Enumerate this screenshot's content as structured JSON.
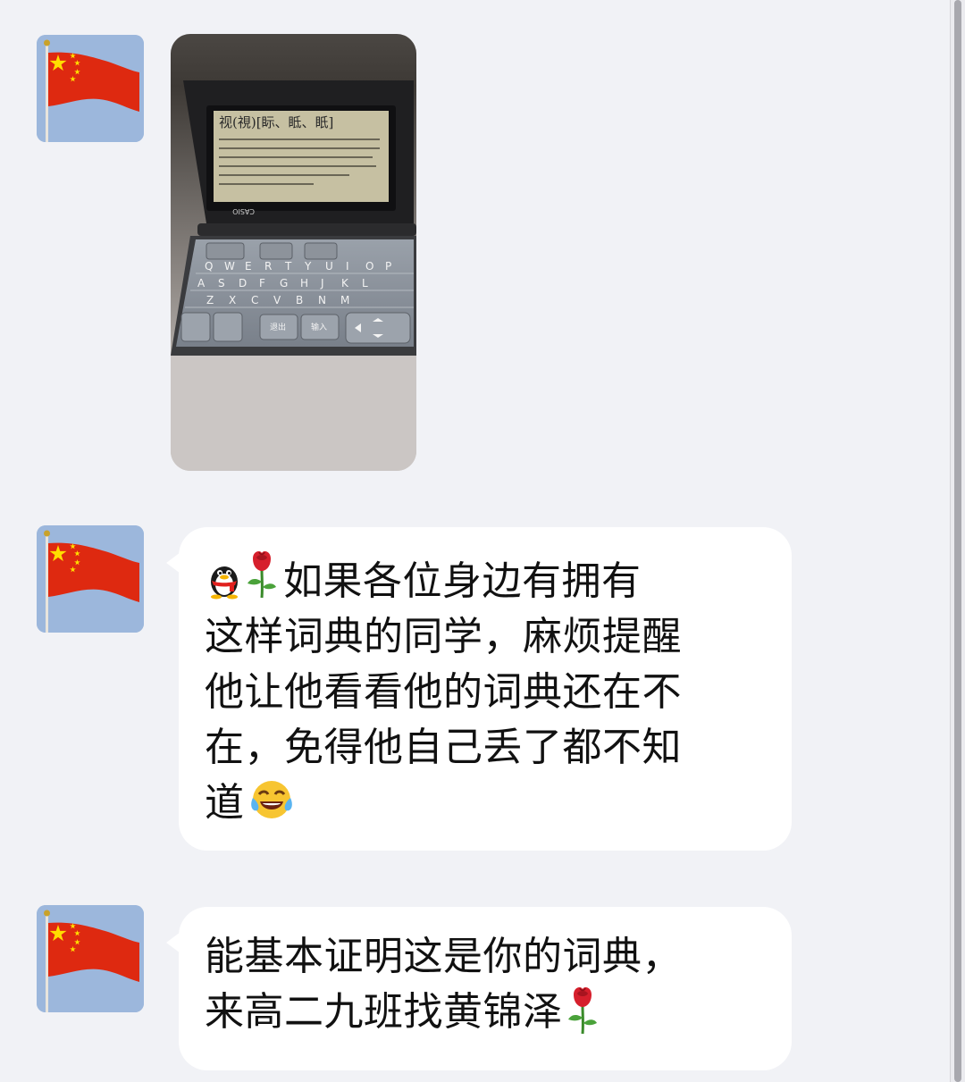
{
  "messages": [
    {
      "type": "image",
      "avatar_icon": "china-flag-icon",
      "photo": {
        "subject": "electronic-dictionary-photo",
        "brand_text": "CASIO",
        "screen_heading": "视(視)[眎、眡、眂]",
        "key_row_1": [
          "Q",
          "W",
          "E",
          "R",
          "T",
          "Y",
          "U",
          "I",
          "O",
          "P"
        ],
        "key_row_2": [
          "A",
          "S",
          "D",
          "F",
          "G",
          "H",
          "J",
          "K",
          "L"
        ],
        "key_row_3": [
          "Z",
          "X",
          "C",
          "V",
          "B",
          "N",
          "M"
        ],
        "key_back": "退出",
        "key_enter": "输入"
      }
    },
    {
      "type": "text",
      "avatar_icon": "china-flag-icon",
      "lead_icons": [
        "qq-penguin-icon",
        "rose-icon"
      ],
      "lines": [
        "如果各位身边有拥有",
        "这样词典的同学，麻烦提醒",
        "他让他看看他的词典还在不",
        "在，免得他自己丢了都不知",
        "道"
      ],
      "trail_icon": "tears-of-joy-icon"
    },
    {
      "type": "text",
      "avatar_icon": "china-flag-icon",
      "lines": [
        "能基本证明这是你的词典，",
        "来高二九班找黄锦泽"
      ],
      "trail_icon": "rose-icon"
    }
  ],
  "colors": {
    "background": "#f1f2f6",
    "bubble": "#ffffff",
    "flag_red": "#de2910",
    "flag_star": "#ffde00",
    "avatar_sky": "#9cb7dc"
  }
}
